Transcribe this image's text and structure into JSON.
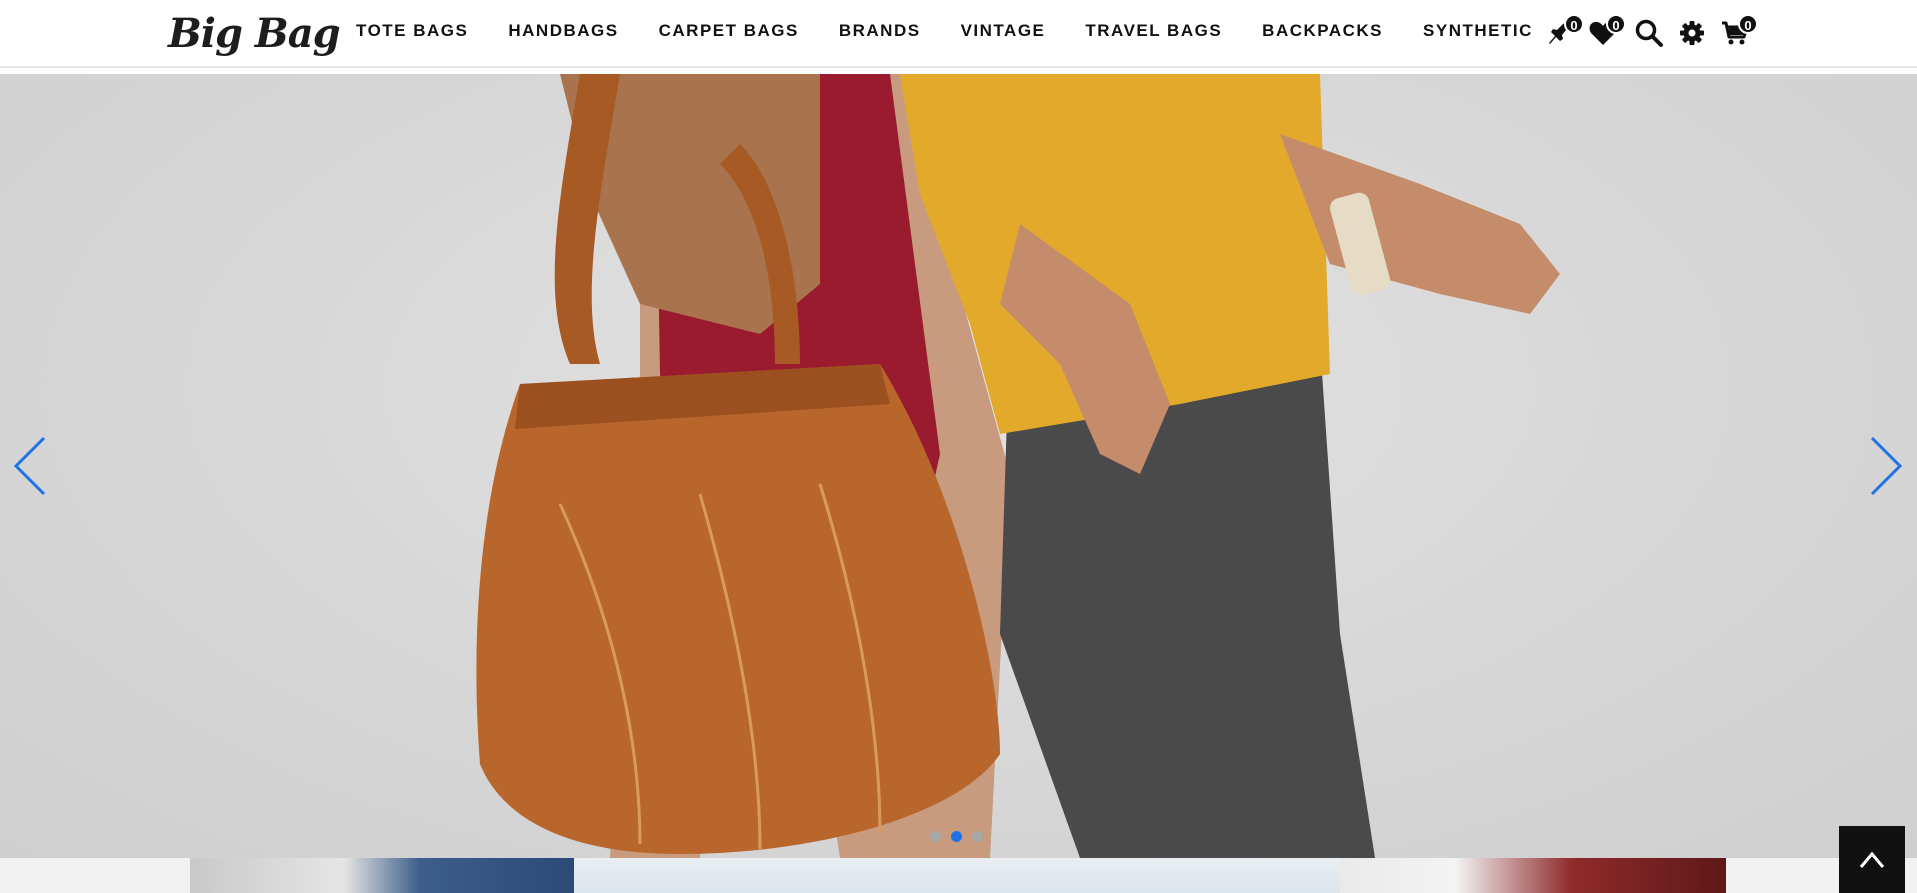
{
  "brand": {
    "logo_text": "Big Bag"
  },
  "nav": {
    "items": [
      {
        "label": "TOTE BAGS"
      },
      {
        "label": "HANDBAGS"
      },
      {
        "label": "CARPET BAGS"
      },
      {
        "label": "BRANDS"
      },
      {
        "label": "VINTAGE"
      },
      {
        "label": "TRAVEL BAGS"
      },
      {
        "label": "BACKPACKS"
      },
      {
        "label": "SYNTHETIC"
      }
    ]
  },
  "header_icons": {
    "compare": {
      "icon": "compare-pin-icon",
      "count": "0"
    },
    "wishlist": {
      "icon": "heart-icon",
      "count": "0"
    },
    "search": {
      "icon": "search-icon"
    },
    "settings": {
      "icon": "gear-icon"
    },
    "cart": {
      "icon": "cart-icon",
      "count": "0"
    }
  },
  "slider": {
    "total_slides": 3,
    "active_slide": 2,
    "prev_icon": "chevron-left-icon",
    "next_icon": "chevron-right-icon"
  },
  "back_to_top": {
    "icon": "chevron-up-icon"
  },
  "colors": {
    "accent": "#1e74e6",
    "text": "#111111",
    "badge_bg": "#111111",
    "hero_bg": "#d9d9d9",
    "bag": "#b8662c",
    "sweater": "#e2a92b",
    "pants": "#4a4a4a",
    "dress": "#9b1b2e"
  }
}
